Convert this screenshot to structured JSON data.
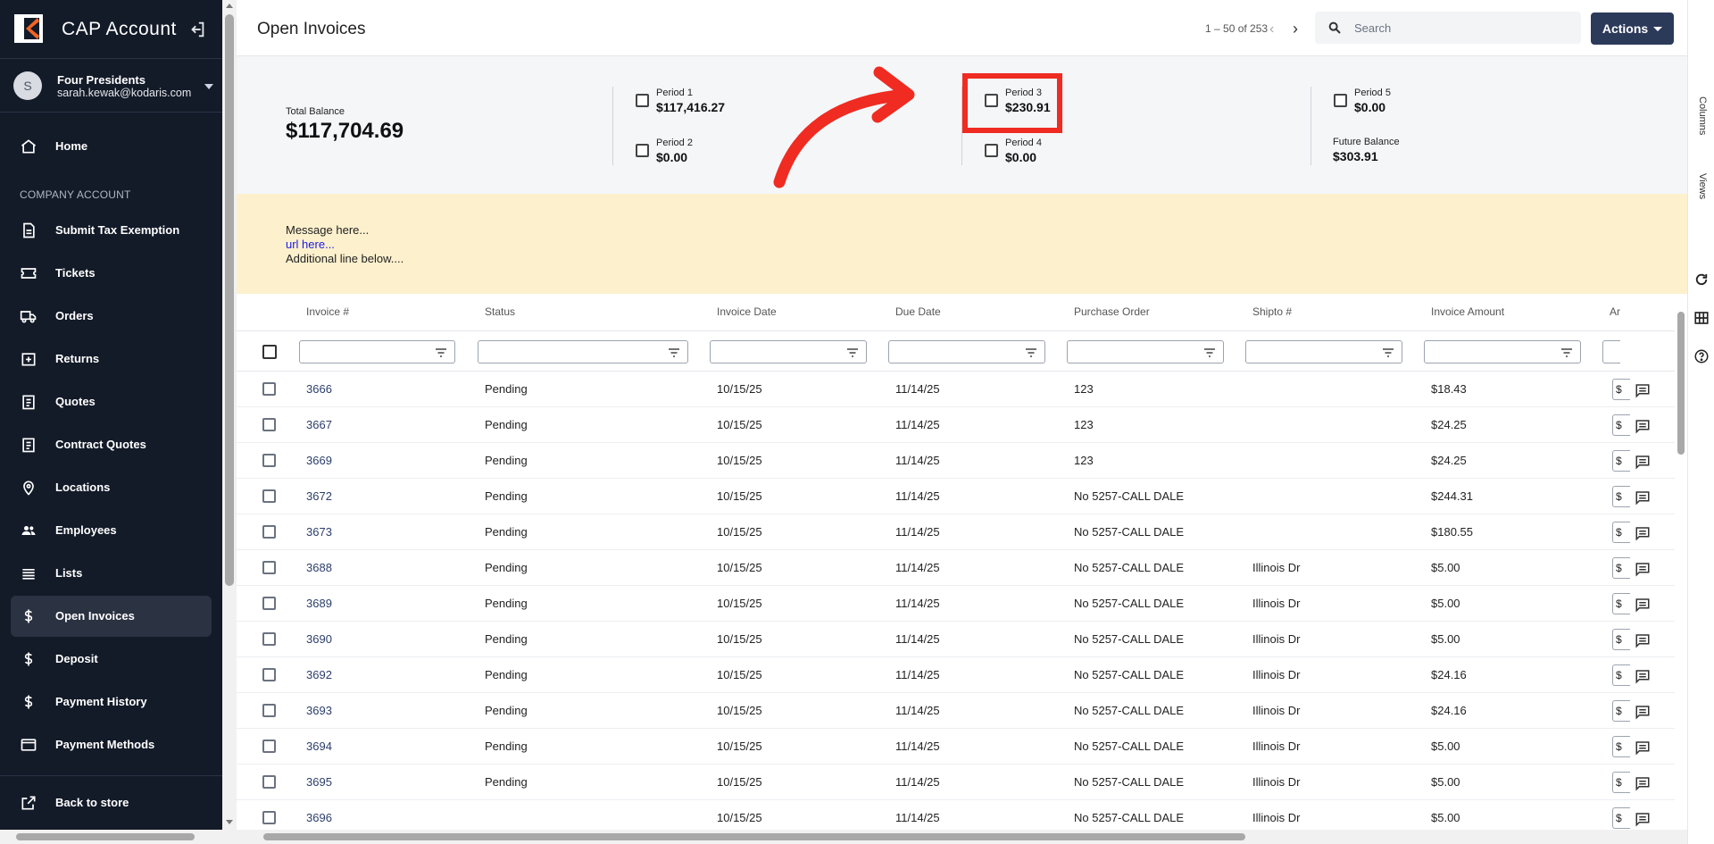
{
  "sidebar": {
    "brand": "CAP Account",
    "account": {
      "initial": "S",
      "name": "Four Presidents",
      "email": "sarah.kewak@kodaris.com"
    },
    "section_label": "COMPANY ACCOUNT",
    "items": [
      {
        "label": "Home",
        "icon": "home-icon"
      },
      {
        "label": "Submit Tax Exemption",
        "icon": "document-icon"
      },
      {
        "label": "Tickets",
        "icon": "ticket-icon"
      },
      {
        "label": "Orders",
        "icon": "truck-icon"
      },
      {
        "label": "Returns",
        "icon": "return-icon"
      },
      {
        "label": "Quotes",
        "icon": "clipboard-icon"
      },
      {
        "label": "Contract Quotes",
        "icon": "clipboard-icon"
      },
      {
        "label": "Locations",
        "icon": "location-pin-icon"
      },
      {
        "label": "Employees",
        "icon": "people-icon"
      },
      {
        "label": "Lists",
        "icon": "list-icon"
      },
      {
        "label": "Open Invoices",
        "icon": "dollar-icon",
        "active": true
      },
      {
        "label": "Deposit",
        "icon": "dollar-icon"
      },
      {
        "label": "Payment History",
        "icon": "dollar-icon"
      },
      {
        "label": "Payment Methods",
        "icon": "credit-card-icon"
      }
    ],
    "back_to_store": "Back to store"
  },
  "header": {
    "title": "Open Invoices",
    "pager": "1 – 50 of 253",
    "search_placeholder": "Search",
    "actions_label": "Actions"
  },
  "summary": {
    "total_balance_label": "Total Balance",
    "total_balance": "$117,704.69",
    "periods": [
      {
        "label": "Period 1",
        "value": "$117,416.27"
      },
      {
        "label": "Period 2",
        "value": "$0.00"
      },
      {
        "label": "Period 3",
        "value": "$230.91"
      },
      {
        "label": "Period 4",
        "value": "$0.00"
      },
      {
        "label": "Period 5",
        "value": "$0.00"
      }
    ],
    "future_balance_label": "Future Balance",
    "future_balance": "$303.91",
    "annotation_color": "#ef2b22"
  },
  "banner": {
    "line1": "Message here...",
    "link": "url here...",
    "line3": "Additional line below...."
  },
  "table": {
    "columns": [
      "Invoice #",
      "Status",
      "Invoice Date",
      "Due Date",
      "Purchase Order",
      "Shipto #",
      "Invoice Amount",
      "Ar"
    ],
    "truncated_cell": "$",
    "rows": [
      {
        "invoice": "3666",
        "status": "Pending",
        "invoice_date": "10/15/25",
        "due_date": "11/14/25",
        "po": "123",
        "shipto": "",
        "amount": "$18.43"
      },
      {
        "invoice": "3667",
        "status": "Pending",
        "invoice_date": "10/15/25",
        "due_date": "11/14/25",
        "po": "123",
        "shipto": "",
        "amount": "$24.25"
      },
      {
        "invoice": "3669",
        "status": "Pending",
        "invoice_date": "10/15/25",
        "due_date": "11/14/25",
        "po": "123",
        "shipto": "",
        "amount": "$24.25"
      },
      {
        "invoice": "3672",
        "status": "Pending",
        "invoice_date": "10/15/25",
        "due_date": "11/14/25",
        "po": "No 5257-CALL DALE",
        "shipto": "",
        "amount": "$244.31"
      },
      {
        "invoice": "3673",
        "status": "Pending",
        "invoice_date": "10/15/25",
        "due_date": "11/14/25",
        "po": "No 5257-CALL DALE",
        "shipto": "",
        "amount": "$180.55"
      },
      {
        "invoice": "3688",
        "status": "Pending",
        "invoice_date": "10/15/25",
        "due_date": "11/14/25",
        "po": "No 5257-CALL DALE",
        "shipto": "Illinois Dr",
        "amount": "$5.00"
      },
      {
        "invoice": "3689",
        "status": "Pending",
        "invoice_date": "10/15/25",
        "due_date": "11/14/25",
        "po": "No 5257-CALL DALE",
        "shipto": "Illinois Dr",
        "amount": "$5.00"
      },
      {
        "invoice": "3690",
        "status": "Pending",
        "invoice_date": "10/15/25",
        "due_date": "11/14/25",
        "po": "No 5257-CALL DALE",
        "shipto": "Illinois Dr",
        "amount": "$5.00"
      },
      {
        "invoice": "3692",
        "status": "Pending",
        "invoice_date": "10/15/25",
        "due_date": "11/14/25",
        "po": "No 5257-CALL DALE",
        "shipto": "Illinois Dr",
        "amount": "$24.16"
      },
      {
        "invoice": "3693",
        "status": "Pending",
        "invoice_date": "10/15/25",
        "due_date": "11/14/25",
        "po": "No 5257-CALL DALE",
        "shipto": "Illinois Dr",
        "amount": "$24.16"
      },
      {
        "invoice": "3694",
        "status": "Pending",
        "invoice_date": "10/15/25",
        "due_date": "11/14/25",
        "po": "No 5257-CALL DALE",
        "shipto": "Illinois Dr",
        "amount": "$5.00"
      },
      {
        "invoice": "3695",
        "status": "Pending",
        "invoice_date": "10/15/25",
        "due_date": "11/14/25",
        "po": "No 5257-CALL DALE",
        "shipto": "Illinois Dr",
        "amount": "$5.00"
      },
      {
        "invoice": "3696",
        "status": "",
        "invoice_date": "10/15/25",
        "due_date": "11/14/25",
        "po": "No 5257-CALL DALE",
        "shipto": "Illinois Dr",
        "amount": "$5.00"
      }
    ]
  },
  "right_rail": {
    "columns_label": "Columns",
    "views_label": "Views"
  },
  "colors": {
    "sidebar_bg": "#131a28",
    "accent": "#2c3a5a",
    "banner_bg": "#fdf0cd",
    "link": "#2c3e6b"
  }
}
